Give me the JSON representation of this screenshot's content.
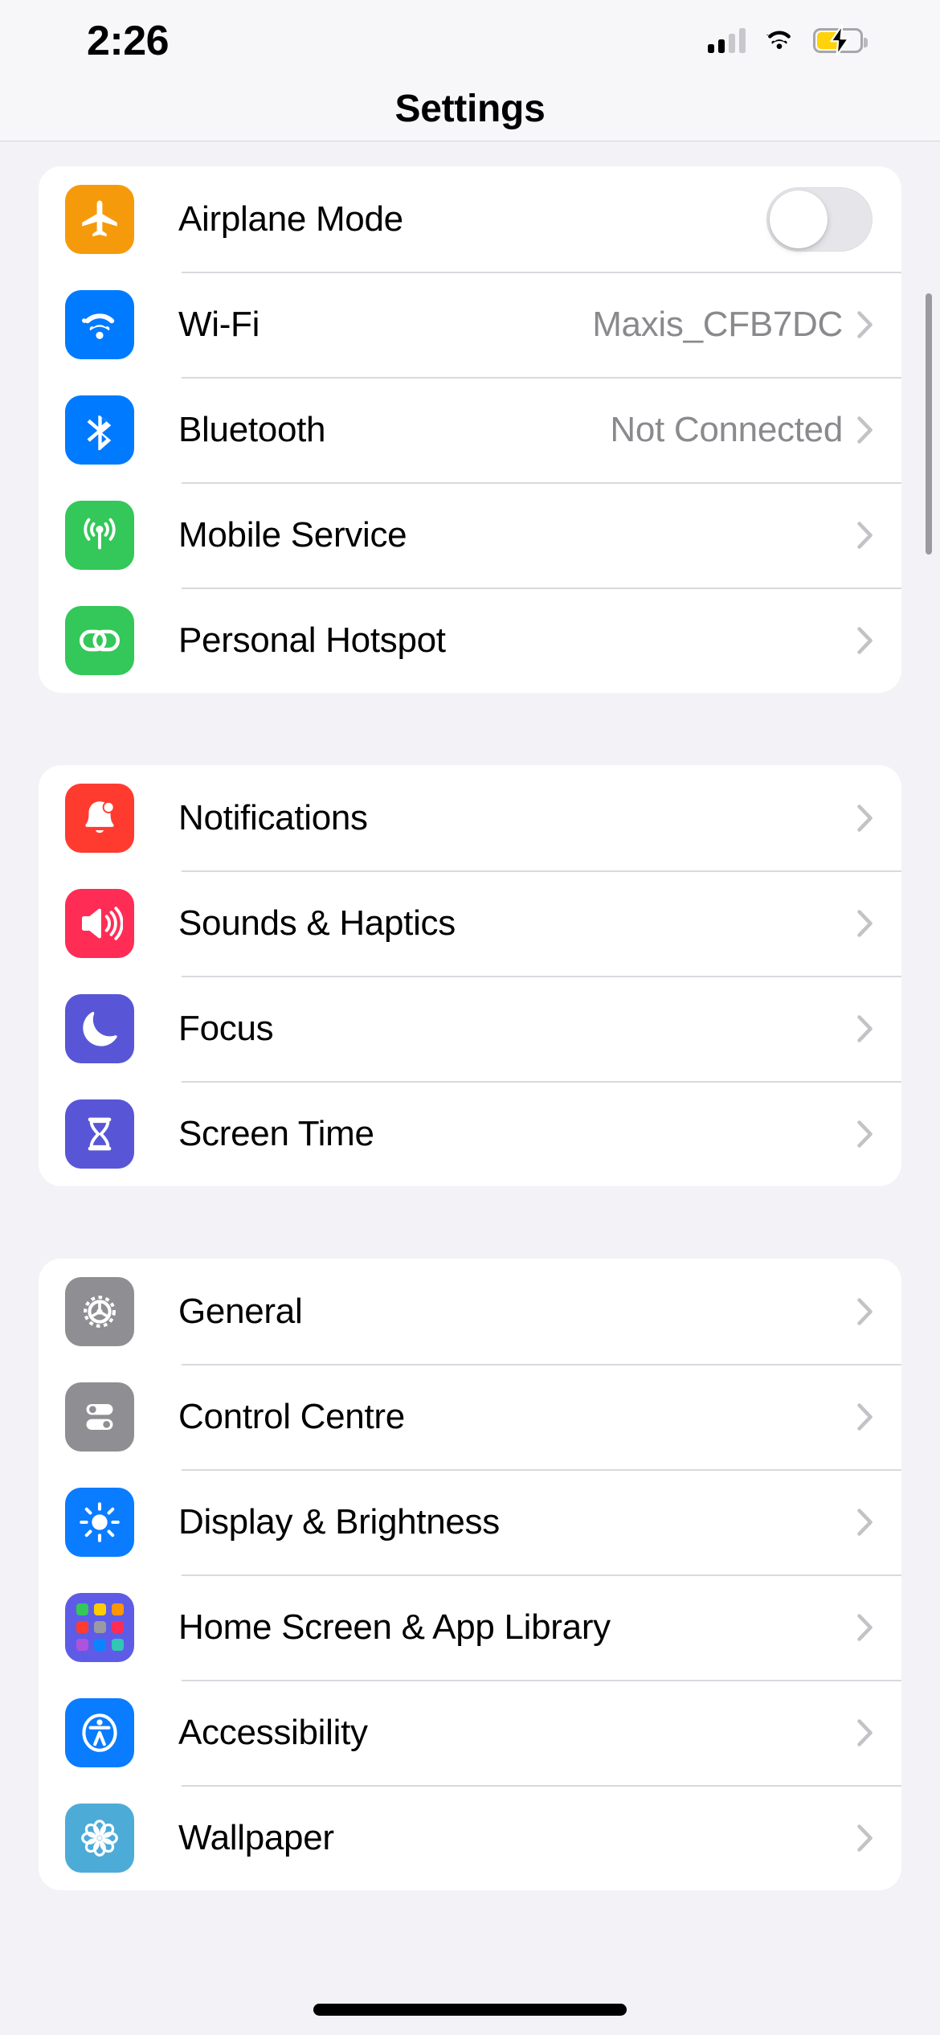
{
  "status_bar": {
    "time": "2:26",
    "signal_icon": "cellular-signal-icon",
    "signal_bars_total": 4,
    "signal_bars_active": 2,
    "wifi_icon": "wifi-icon",
    "battery_icon": "battery-charging-icon",
    "battery_color": "#FFD20A",
    "battery_level_percent": 55,
    "battery_charging": true
  },
  "header": {
    "title": "Settings"
  },
  "colors": {
    "page_background": "#F2F2F7",
    "card_background": "#FFFFFF",
    "separator": "#D9D9DE",
    "primary_text": "#000000",
    "secondary_text": "#8A8A8E",
    "chevron": "#C3C3C7",
    "accent_blue": "#007AFF",
    "accent_green": "#34C759",
    "accent_orange": "#F59B0B",
    "accent_red": "#FF3B30",
    "accent_pink": "#FF2D55",
    "accent_purple": "#5856D6",
    "accent_gray": "#8E8E93",
    "accent_teal": "#4DABD8",
    "toggle_off_track": "#E6E6EA"
  },
  "groups": [
    {
      "id": "connectivity",
      "rows": [
        {
          "id": "airplane-mode",
          "label": "Airplane Mode",
          "icon": "airplane-icon",
          "icon_color": "#F59B0B",
          "accessory": "toggle",
          "toggle_on": false
        },
        {
          "id": "wifi",
          "label": "Wi-Fi",
          "icon": "wifi-icon",
          "icon_color": "#007AFF",
          "accessory": "chevron",
          "value": "Maxis_CFB7DC"
        },
        {
          "id": "bluetooth",
          "label": "Bluetooth",
          "icon": "bluetooth-icon",
          "icon_color": "#007AFF",
          "accessory": "chevron",
          "value": "Not Connected"
        },
        {
          "id": "mobile-service",
          "label": "Mobile Service",
          "icon": "antenna-icon",
          "icon_color": "#34C759",
          "accessory": "chevron",
          "value": ""
        },
        {
          "id": "personal-hotspot",
          "label": "Personal Hotspot",
          "icon": "link-chain-icon",
          "icon_color": "#34C759",
          "accessory": "chevron",
          "value": ""
        }
      ]
    },
    {
      "id": "alerts",
      "rows": [
        {
          "id": "notifications",
          "label": "Notifications",
          "icon": "bell-icon",
          "icon_color": "#FF3B30",
          "accessory": "chevron",
          "value": ""
        },
        {
          "id": "sounds-haptics",
          "label": "Sounds & Haptics",
          "icon": "speaker-waves-icon",
          "icon_color": "#FF2D55",
          "accessory": "chevron",
          "value": ""
        },
        {
          "id": "focus",
          "label": "Focus",
          "icon": "moon-icon",
          "icon_color": "#5856D6",
          "accessory": "chevron",
          "value": ""
        },
        {
          "id": "screen-time",
          "label": "Screen Time",
          "icon": "hourglass-icon",
          "icon_color": "#5856D6",
          "accessory": "chevron",
          "value": ""
        }
      ]
    },
    {
      "id": "system",
      "rows": [
        {
          "id": "general",
          "label": "General",
          "icon": "gear-icon",
          "icon_color": "#8E8E93",
          "accessory": "chevron",
          "value": ""
        },
        {
          "id": "control-centre",
          "label": "Control Centre",
          "icon": "sliders-icon",
          "icon_color": "#8E8E93",
          "accessory": "chevron",
          "value": ""
        },
        {
          "id": "display-brightness",
          "label": "Display & Brightness",
          "icon": "sun-icon",
          "icon_color": "#0A7CFF",
          "accessory": "chevron",
          "value": ""
        },
        {
          "id": "home-screen-app-library",
          "label": "Home Screen & App Library",
          "icon": "app-grid-icon",
          "icon_color": "#5E5CE6",
          "accessory": "chevron",
          "value": ""
        },
        {
          "id": "accessibility",
          "label": "Accessibility",
          "icon": "accessibility-icon",
          "icon_color": "#0A7CFF",
          "accessory": "chevron",
          "value": ""
        },
        {
          "id": "wallpaper",
          "label": "Wallpaper",
          "icon": "flower-icon",
          "icon_color": "#4DABD8",
          "accessory": "chevron",
          "value": ""
        }
      ]
    }
  ],
  "scrollbar": {
    "visible": true
  },
  "home_indicator": {
    "visible": true
  }
}
